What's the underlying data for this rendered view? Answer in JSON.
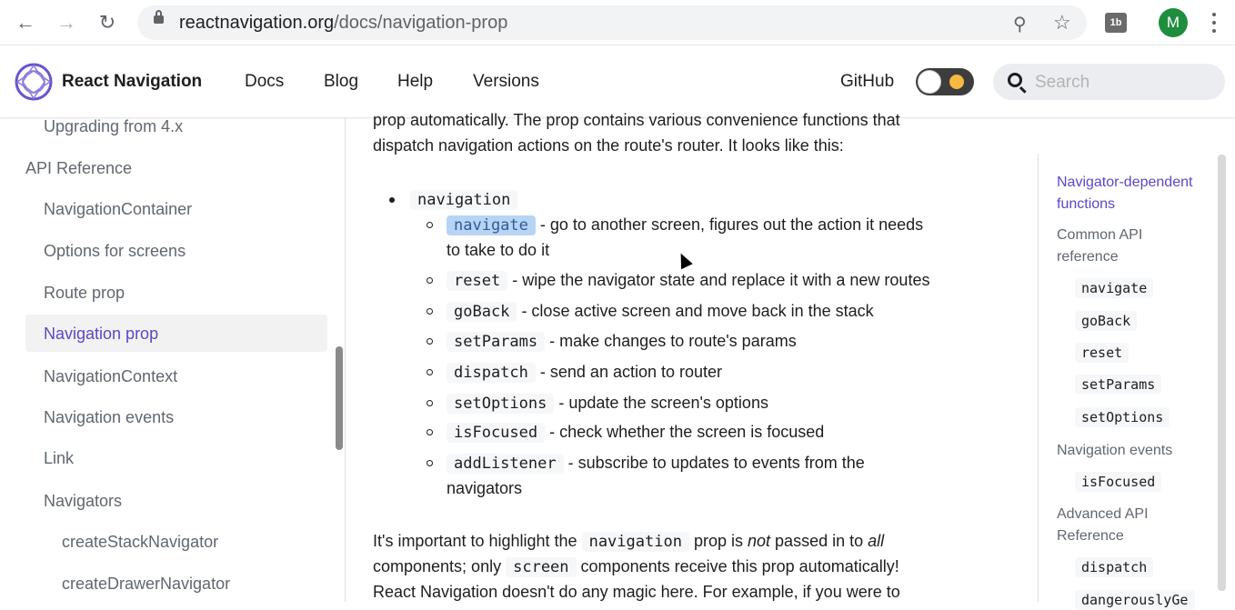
{
  "browser": {
    "url_host": "reactnavigation.org",
    "url_path": "/docs/navigation-prop",
    "extension_label": "1b",
    "avatar_letter": "M"
  },
  "navbar": {
    "brand": "React Navigation",
    "links": [
      "Docs",
      "Blog",
      "Help",
      "Versions"
    ],
    "github": "GitHub",
    "search_placeholder": "Search"
  },
  "sidebar": {
    "items": [
      "Upgrading from 4.x",
      "API Reference",
      "NavigationContainer",
      "Options for screens",
      "Route prop",
      "Navigation prop",
      "NavigationContext",
      "Navigation events",
      "Link",
      "Navigators",
      "createStackNavigator",
      "createDrawerNavigator"
    ],
    "active": "Navigation prop"
  },
  "content": {
    "intro_line1": "prop automatically. The prop contains various convenience functions that",
    "intro_line2": "dispatch navigation actions on the route's router. It looks like this:",
    "top_item": "navigation",
    "methods": [
      {
        "code": "navigate",
        "desc": "- go to another screen, figures out the action it needs",
        "desc2": "to take to do it"
      },
      {
        "code": "reset",
        "desc": "- wipe the navigator state and replace it with a new routes"
      },
      {
        "code": "goBack",
        "desc": "- close active screen and move back in the stack"
      },
      {
        "code": "setParams",
        "desc": "- make changes to route's params"
      },
      {
        "code": "dispatch",
        "desc": "- send an action to router"
      },
      {
        "code": "setOptions",
        "desc": "- update the screen's options"
      },
      {
        "code": "isFocused",
        "desc": "- check whether the screen is focused"
      },
      {
        "code": "addListener",
        "desc": "- subscribe to updates to events from the",
        "desc2": "navigators"
      }
    ],
    "para_a": "It's important to highlight the",
    "para_code1": "navigation",
    "para_b": "prop is",
    "para_not": "not",
    "para_c": "passed in to",
    "para_all": "all",
    "para2_a": "components; only",
    "para2_code": "screen",
    "para2_b": "components receive this prop automatically!",
    "para3": "React Navigation doesn't do any magic here. For example, if you were to"
  },
  "toc": {
    "items": [
      {
        "type": "text",
        "label": "Navigator-dependent",
        "active": true
      },
      {
        "type": "text",
        "label": "functions",
        "active": true
      },
      {
        "type": "text",
        "label": "Common API"
      },
      {
        "type": "text",
        "label": "reference"
      },
      {
        "type": "code",
        "label": "navigate"
      },
      {
        "type": "code",
        "label": "goBack"
      },
      {
        "type": "code",
        "label": "reset"
      },
      {
        "type": "code",
        "label": "setParams"
      },
      {
        "type": "code",
        "label": "setOptions"
      },
      {
        "type": "text",
        "label": "Navigation events"
      },
      {
        "type": "code",
        "label": "isFocused"
      },
      {
        "type": "text",
        "label": "Advanced API"
      },
      {
        "type": "text",
        "label": "Reference"
      },
      {
        "type": "code",
        "label": "dispatch"
      },
      {
        "type": "code",
        "label": "dangerouslyGe"
      }
    ]
  },
  "colors": {
    "accent": "#5b48c6",
    "code_highlight": "#b7d4f5"
  }
}
